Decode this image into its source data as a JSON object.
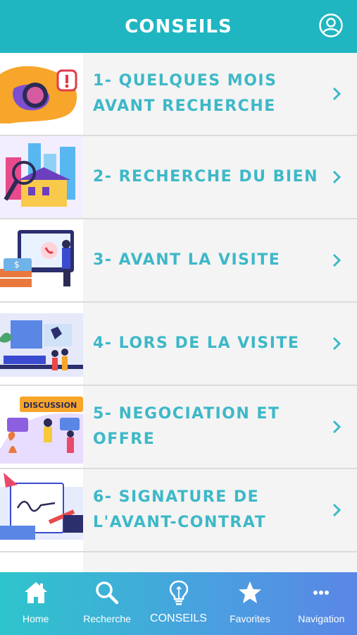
{
  "header": {
    "title": "CONSEILS"
  },
  "items": [
    {
      "label": "1- QUELQUES MOIS AVANT RECHERCHE"
    },
    {
      "label": "2- RECHERCHE DU BIEN"
    },
    {
      "label": "3- AVANT LA VISITE"
    },
    {
      "label": "4- LORS DE LA VISITE"
    },
    {
      "label": "5- NEGOCIATION ET OFFRE",
      "badge": "DISCUSSION"
    },
    {
      "label": "6- SIGNATURE DE L'AVANT-CONTRAT"
    }
  ],
  "tabbar": {
    "tabs": [
      {
        "label": "Home",
        "icon": "home-icon"
      },
      {
        "label": "Recherche",
        "icon": "search-icon"
      },
      {
        "label": "CONSEILS",
        "icon": "lightbulb-icon",
        "active": true
      },
      {
        "label": "Favorites",
        "icon": "star-icon"
      },
      {
        "label": "Navigation",
        "icon": "more-icon"
      }
    ]
  },
  "colors": {
    "header": "#1fb6c2",
    "accent_text": "#3db8c8",
    "tab_gradient_start": "#2ec5cc",
    "tab_gradient_end": "#5a86e6"
  }
}
